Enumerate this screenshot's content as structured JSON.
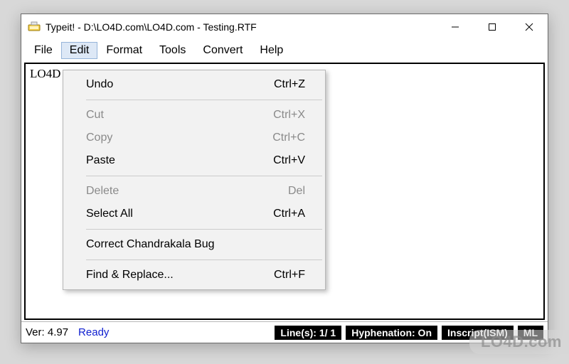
{
  "window": {
    "title": "Typeit! - D:\\LO4D.com\\LO4D.com - Testing.RTF"
  },
  "menubar": {
    "items": [
      {
        "label": "File"
      },
      {
        "label": "Edit"
      },
      {
        "label": "Format"
      },
      {
        "label": "Tools"
      },
      {
        "label": "Convert"
      },
      {
        "label": "Help"
      }
    ]
  },
  "editor": {
    "visible_text": "LO4D"
  },
  "edit_menu": {
    "items": [
      {
        "label": "Undo",
        "shortcut": "Ctrl+Z",
        "enabled": true
      },
      {
        "sep": true
      },
      {
        "label": "Cut",
        "shortcut": "Ctrl+X",
        "enabled": false
      },
      {
        "label": "Copy",
        "shortcut": "Ctrl+C",
        "enabled": false
      },
      {
        "label": "Paste",
        "shortcut": "Ctrl+V",
        "enabled": true
      },
      {
        "sep": true
      },
      {
        "label": "Delete",
        "shortcut": "Del",
        "enabled": false
      },
      {
        "label": "Select All",
        "shortcut": "Ctrl+A",
        "enabled": true
      },
      {
        "sep": true
      },
      {
        "label": "Correct Chandrakala Bug",
        "shortcut": "",
        "enabled": true
      },
      {
        "sep": true
      },
      {
        "label": "Find & Replace...",
        "shortcut": "Ctrl+F",
        "enabled": true
      }
    ]
  },
  "statusbar": {
    "version": "Ver: 4.97",
    "ready": "Ready",
    "lines": "Line(s):  1/ 1",
    "hyphenation": "Hyphenation: On",
    "mode": "Inscript(ISM)",
    "lang": "ML"
  },
  "watermark": "LO4D.com"
}
